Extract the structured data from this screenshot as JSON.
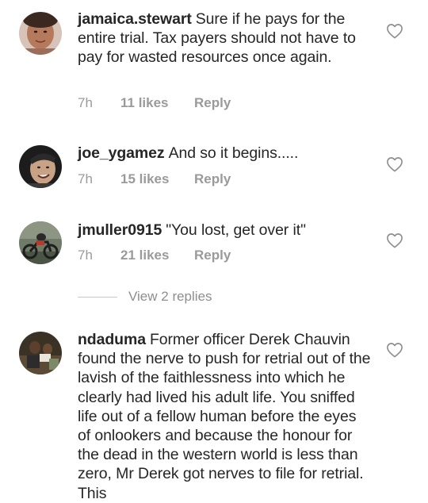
{
  "comments": [
    {
      "username": "jamaica.stewart",
      "text": "Sure if he pays for the entire trial. Tax payers should not have to pay for wasted resources once again.",
      "time": "7h",
      "likes": "11 likes",
      "reply": "Reply",
      "avatar_icon": "profile-photo-woman"
    },
    {
      "username": "joe_ygamez",
      "text": "And so it begins.....",
      "time": "7h",
      "likes": "15 likes",
      "reply": "Reply",
      "avatar_icon": "profile-photo-face"
    },
    {
      "username": "jmuller0915",
      "text": "\"You lost, get over it\"",
      "time": "7h",
      "likes": "21 likes",
      "reply": "Reply",
      "avatar_icon": "profile-photo-motorcycle"
    },
    {
      "username": "ndaduma",
      "text": "Former officer Derek Chauvin found the nerve to push for retrial out of the lavish of the faithlessness into which he clearly had lived his adult life. You sniffed life out of a fellow human before the eyes of onlookers and because the honour for the dead in the western world is less than zero, Mr Derek got nerves to file for retrial. This",
      "avatar_icon": "profile-photo-group"
    }
  ],
  "view_replies": "View 2 replies",
  "colors": {
    "text": "#262626",
    "meta": "#9a9a9a",
    "divider": "#c7c7c7",
    "heart_outline": "#8e8e8e"
  },
  "icons": {
    "like": "heart-outline-icon"
  }
}
